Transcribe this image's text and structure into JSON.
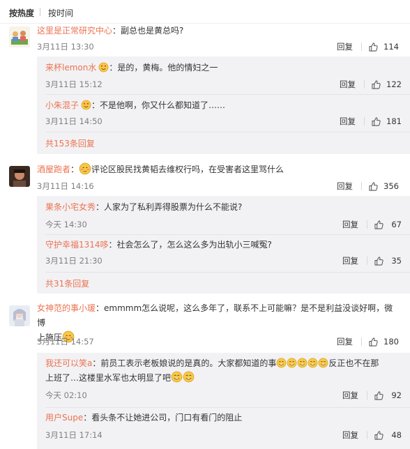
{
  "sort": {
    "hot": "按热度",
    "time": "按时间"
  },
  "actions": {
    "reply": "回复"
  },
  "comments": [
    {
      "user": "这里是正常研究中心",
      "text": "：副总也是黄总吗?",
      "time": "3月11日 13:30",
      "likes": "114",
      "replies": [
        {
          "user": "来杯lemon水",
          "text": "：是的，黄梅。他的情妇之一",
          "time": "3月11日 15:12",
          "likes": "122"
        },
        {
          "user": "小朱混子",
          "text": "：不是他啊，你又什么都知道了……",
          "time": "3月11日 14:50",
          "likes": "181"
        }
      ],
      "more": "共153条回复"
    },
    {
      "user": "酒屋跑者",
      "text": "评论区股民找黄韬去维权行吗，在受害者这里骂什么",
      "time": "3月11日 14:16",
      "likes": "356",
      "replies": [
        {
          "user": "果条小宅女秀",
          "text": "：人家为了私利弄得股票为什么不能说?",
          "time": "今天 14:30",
          "likes": "67"
        },
        {
          "user": "守护幸福1314哆",
          "text": "：社会怎么了，怎么这么多为出轨小三喊冤?",
          "time": "3月11日 21:30",
          "likes": "35"
        }
      ],
      "more": "共31条回复"
    },
    {
      "user": "女神范的事小瑗",
      "text1": "：emmmm怎么说呢，这么多年了，联系不上可能嘛？是不是利益没谈好啊，微博",
      "text2": "上施压",
      "time": "3月11日 14:57",
      "likes": "180",
      "replies": [
        {
          "user": "我还可以笑a",
          "text1": "：前员工表示老板娘说的是真的。大家都知道的事",
          "text1b": "反正也不在那",
          "text2": "上班了…这楼里水军也太明显了吧",
          "time": "今天 02:10",
          "likes": "92"
        },
        {
          "user": "用户Supe",
          "text": "：看头条不让她进公司，门口有看门的阻止",
          "time": "3月11日 17:14",
          "likes": "48"
        }
      ]
    }
  ],
  "colors": {
    "username": "#eb7350",
    "reply_bg": "#f2f2f5",
    "meta": "#808080"
  }
}
